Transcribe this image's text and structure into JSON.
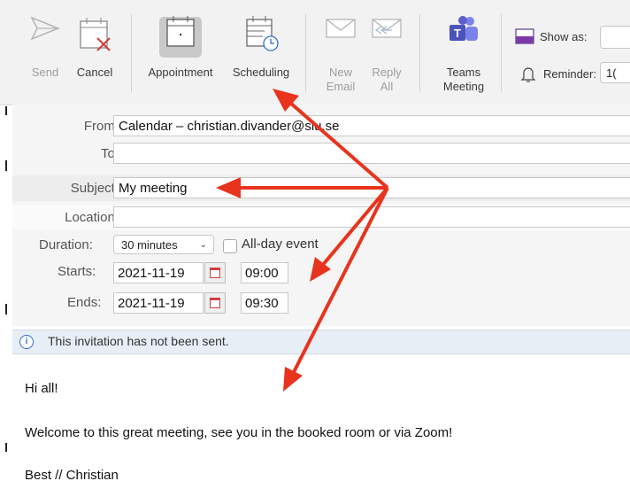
{
  "ribbon": {
    "send": "Send",
    "cancel": "Cancel",
    "appointment": "Appointment",
    "scheduling": "Scheduling",
    "new_email": "New\nEmail",
    "reply_all": "Reply\nAll",
    "teams_meeting": "Teams\nMeeting",
    "show_as": "Show as:",
    "reminder": "Reminder:",
    "reminder_value": "1("
  },
  "form": {
    "from_label": "From:",
    "from_value": "Calendar – christian.divander@slu.se",
    "to_label": "To:",
    "to_value": "",
    "subject_label": "Subject:",
    "subject_value": "My meeting",
    "location_label": "Location:",
    "location_value": "",
    "duration_label": "Duration:",
    "duration_value": "30 minutes",
    "allday_label": "All-day event",
    "starts_label": "Starts:",
    "starts_date": "2021-11-19",
    "starts_time": "09:00",
    "ends_label": "Ends:",
    "ends_date": "2021-11-19",
    "ends_time": "09:30"
  },
  "banner": {
    "info_icon": "i",
    "text": "This invitation has not been sent."
  },
  "body": {
    "line1": "Hi all!",
    "line2": "Welcome to this great meeting, see you in the booked room or via Zoom!",
    "line3": "Best // Christian"
  },
  "colors": {
    "arrow": "#e8331d",
    "accent_teams": "#5b5fc7"
  }
}
